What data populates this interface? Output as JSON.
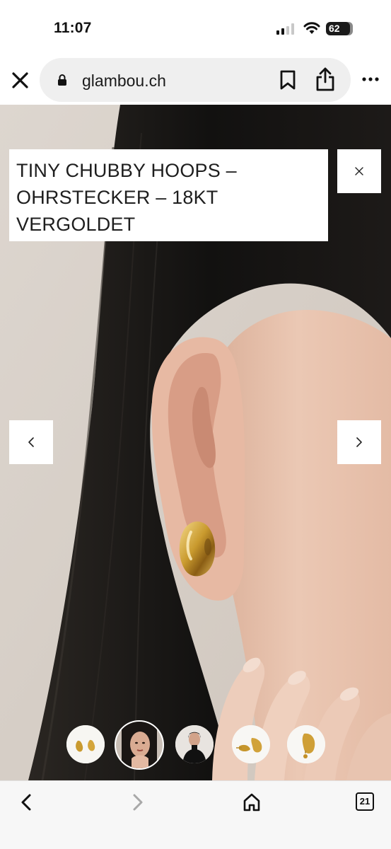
{
  "status_bar": {
    "time": "11:07",
    "battery_percent": "62",
    "signal_bars_active": 2,
    "signal_bars_total": 4
  },
  "browser": {
    "url": "glambou.ch",
    "icons": [
      "close-icon",
      "lock-icon",
      "bookmark-icon",
      "share-icon",
      "more-icon"
    ]
  },
  "gallery": {
    "product_title": "TINY CHUBBY HOOPS – OHRSTECKER – 18KT VERGOLDET",
    "controls": [
      "close-icon",
      "chevron-left-icon",
      "chevron-right-icon"
    ],
    "thumbnails": [
      {
        "subject": "earrings pair",
        "active": false
      },
      {
        "subject": "model portrait",
        "active": true
      },
      {
        "subject": "model in black",
        "active": false
      },
      {
        "subject": "earrings side view",
        "active": false
      },
      {
        "subject": "single earring",
        "active": false
      }
    ]
  },
  "toolbar": {
    "tabs_count": "21",
    "icons": [
      "back-arrow-icon",
      "forward-arrow-icon",
      "home-icon",
      "tabs-icon"
    ]
  },
  "colors": {
    "gold": "#c99a2e",
    "hair": "#141414",
    "skin": "#e8c2ad",
    "background": "#d9d2ca",
    "url_pill": "#efefef"
  }
}
